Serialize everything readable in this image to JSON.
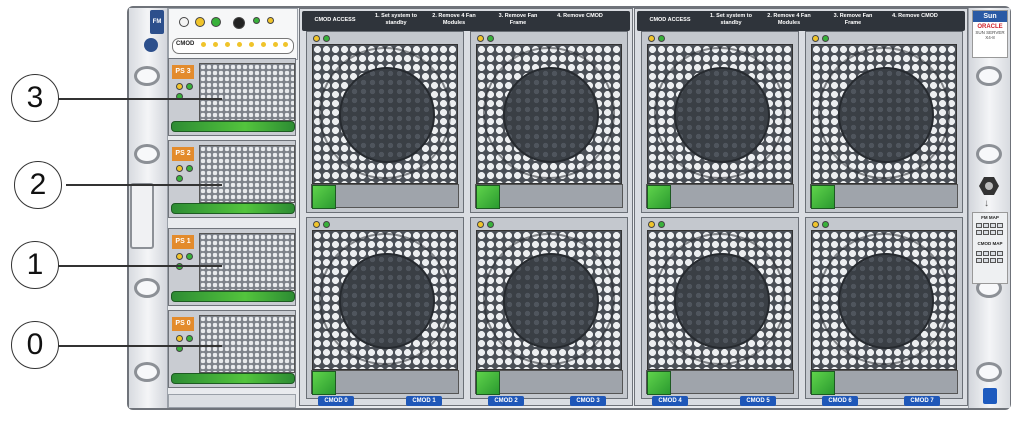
{
  "callouts": [
    "3",
    "2",
    "1",
    "0"
  ],
  "power_supplies": [
    {
      "label": "PS 3"
    },
    {
      "label": "PS 2"
    },
    {
      "label": "PS 1"
    },
    {
      "label": "PS 0"
    }
  ],
  "status_panel": {
    "label": "CMOD"
  },
  "fan_module_label": "FM",
  "cmod_access_bars": [
    {
      "title": "CMOD ACCESS",
      "steps": [
        "1. Set system to standby",
        "2. Remove 4 Fan Modules",
        "3. Remove Fan Frame",
        "4. Remove CMOD"
      ]
    },
    {
      "title": "CMOD ACCESS",
      "steps": [
        "1. Set system to standby",
        "2. Remove 4 Fan Modules",
        "3. Remove Fan Frame",
        "4. Remove CMOD"
      ]
    }
  ],
  "cmod_labels": [
    "CMOD 0",
    "CMOD 1",
    "CMOD 2",
    "CMOD 3",
    "CMOD 4",
    "CMOD 5",
    "CMOD 6",
    "CMOD 7"
  ],
  "brand": {
    "sun": "Sun",
    "oracle": "ORACLE",
    "model": "SUN SERVER X4-8"
  },
  "map_panel": {
    "fm_map": "FM MAP",
    "cmod_map": "CMOD MAP"
  },
  "colors": {
    "psu_label": "#e38b2c",
    "handle_green": "#53c43d",
    "cmod_tag_blue": "#1f57b8",
    "fan_mesh": "#4a4f56"
  }
}
